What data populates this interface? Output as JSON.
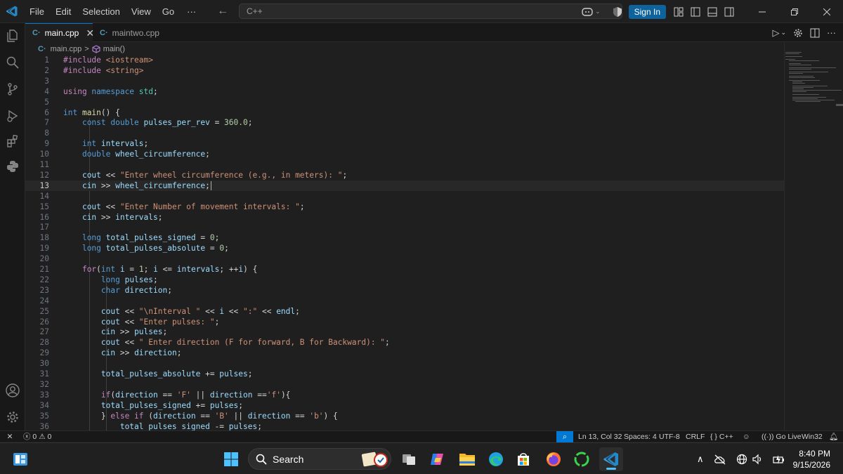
{
  "titlebar": {
    "menu": [
      "File",
      "Edit",
      "Selection",
      "View",
      "Go"
    ],
    "more": "···",
    "command_center": "C++",
    "signin_label": "Sign In"
  },
  "tabs": [
    {
      "label": "main.cpp",
      "active": true,
      "icon": "cpp-file-icon"
    },
    {
      "label": "maintwo.cpp",
      "active": false,
      "icon": "cpp-file-icon"
    }
  ],
  "breadcrumb": {
    "file": "main.cpp",
    "separator": ">",
    "symbol": "main()"
  },
  "editor": {
    "current_line": 13,
    "lines": [
      {
        "n": "1",
        "tokens": [
          [
            "pp",
            "#include "
          ],
          [
            "str",
            "<iostream>"
          ]
        ]
      },
      {
        "n": "2",
        "tokens": [
          [
            "pp",
            "#include "
          ],
          [
            "str",
            "<string>"
          ]
        ]
      },
      {
        "n": "3",
        "tokens": []
      },
      {
        "n": "4",
        "tokens": [
          [
            "kw2",
            "using "
          ],
          [
            "kw",
            "namespace "
          ],
          [
            "ty2",
            "std"
          ],
          [
            "op",
            ";"
          ]
        ]
      },
      {
        "n": "5",
        "tokens": []
      },
      {
        "n": "6",
        "tokens": [
          [
            "type",
            "int "
          ],
          [
            "fn",
            "main"
          ],
          [
            "op",
            "() {"
          ]
        ]
      },
      {
        "n": "7",
        "tokens": [
          [
            "op",
            "    "
          ],
          [
            "kw",
            "const "
          ],
          [
            "type",
            "double "
          ],
          [
            "var",
            "pulses_per_rev"
          ],
          [
            "op",
            " = "
          ],
          [
            "num",
            "360.0"
          ],
          [
            "op",
            ";"
          ]
        ]
      },
      {
        "n": "8",
        "tokens": []
      },
      {
        "n": "9",
        "tokens": [
          [
            "op",
            "    "
          ],
          [
            "type",
            "int "
          ],
          [
            "var",
            "intervals"
          ],
          [
            "op",
            ";"
          ]
        ]
      },
      {
        "n": "10",
        "tokens": [
          [
            "op",
            "    "
          ],
          [
            "type",
            "double "
          ],
          [
            "var",
            "wheel_circumference"
          ],
          [
            "op",
            ";"
          ]
        ]
      },
      {
        "n": "11",
        "tokens": []
      },
      {
        "n": "12",
        "tokens": [
          [
            "op",
            "    "
          ],
          [
            "var",
            "cout"
          ],
          [
            "op",
            " << "
          ],
          [
            "str",
            "\"Enter wheel circumference (e.g., in meters): \""
          ],
          [
            "op",
            ";"
          ]
        ]
      },
      {
        "n": "13",
        "tokens": [
          [
            "op",
            "    "
          ],
          [
            "var",
            "cin"
          ],
          [
            "op",
            " >> "
          ],
          [
            "var",
            "wheel_circumference"
          ],
          [
            "op",
            ";"
          ]
        ]
      },
      {
        "n": "14",
        "tokens": []
      },
      {
        "n": "15",
        "tokens": [
          [
            "op",
            "    "
          ],
          [
            "var",
            "cout"
          ],
          [
            "op",
            " << "
          ],
          [
            "str",
            "\"Enter Number of movement intervals: \""
          ],
          [
            "op",
            ";"
          ]
        ]
      },
      {
        "n": "16",
        "tokens": [
          [
            "op",
            "    "
          ],
          [
            "var",
            "cin"
          ],
          [
            "op",
            " >> "
          ],
          [
            "var",
            "intervals"
          ],
          [
            "op",
            ";"
          ]
        ]
      },
      {
        "n": "17",
        "tokens": []
      },
      {
        "n": "18",
        "tokens": [
          [
            "op",
            "    "
          ],
          [
            "type",
            "long "
          ],
          [
            "var",
            "total_pulses_signed"
          ],
          [
            "op",
            " = "
          ],
          [
            "num",
            "0"
          ],
          [
            "op",
            ";"
          ]
        ]
      },
      {
        "n": "19",
        "tokens": [
          [
            "op",
            "    "
          ],
          [
            "type",
            "long "
          ],
          [
            "var",
            "total_pulses_absolute"
          ],
          [
            "op",
            " = "
          ],
          [
            "num",
            "0"
          ],
          [
            "op",
            ";"
          ]
        ]
      },
      {
        "n": "20",
        "tokens": []
      },
      {
        "n": "21",
        "tokens": [
          [
            "op",
            "    "
          ],
          [
            "kw2",
            "for"
          ],
          [
            "op",
            "("
          ],
          [
            "type",
            "int "
          ],
          [
            "var",
            "i"
          ],
          [
            "op",
            " = "
          ],
          [
            "num",
            "1"
          ],
          [
            "op",
            "; "
          ],
          [
            "var",
            "i"
          ],
          [
            "op",
            " <= "
          ],
          [
            "var",
            "intervals"
          ],
          [
            "op",
            "; ++"
          ],
          [
            "var",
            "i"
          ],
          [
            "op",
            ") {"
          ]
        ]
      },
      {
        "n": "22",
        "tokens": [
          [
            "op",
            "        "
          ],
          [
            "type",
            "long "
          ],
          [
            "var",
            "pulses"
          ],
          [
            "op",
            ";"
          ]
        ]
      },
      {
        "n": "23",
        "tokens": [
          [
            "op",
            "        "
          ],
          [
            "type",
            "char "
          ],
          [
            "var",
            "direction"
          ],
          [
            "op",
            ";"
          ]
        ]
      },
      {
        "n": "24",
        "tokens": []
      },
      {
        "n": "25",
        "tokens": [
          [
            "op",
            "        "
          ],
          [
            "var",
            "cout"
          ],
          [
            "op",
            " << "
          ],
          [
            "str",
            "\"\\nInterval \""
          ],
          [
            "op",
            " << "
          ],
          [
            "var",
            "i"
          ],
          [
            "op",
            " << "
          ],
          [
            "str",
            "\":\""
          ],
          [
            "op",
            " << "
          ],
          [
            "var",
            "endl"
          ],
          [
            "op",
            ";"
          ]
        ]
      },
      {
        "n": "26",
        "tokens": [
          [
            "op",
            "        "
          ],
          [
            "var",
            "cout"
          ],
          [
            "op",
            " << "
          ],
          [
            "str",
            "\"Enter pulses: \""
          ],
          [
            "op",
            ";"
          ]
        ]
      },
      {
        "n": "27",
        "tokens": [
          [
            "op",
            "        "
          ],
          [
            "var",
            "cin"
          ],
          [
            "op",
            " >> "
          ],
          [
            "var",
            "pulses"
          ],
          [
            "op",
            ";"
          ]
        ]
      },
      {
        "n": "28",
        "tokens": [
          [
            "op",
            "        "
          ],
          [
            "var",
            "cout"
          ],
          [
            "op",
            " << "
          ],
          [
            "str",
            "\" Enter direction (F for forward, B for Backward): \""
          ],
          [
            "op",
            ";"
          ]
        ]
      },
      {
        "n": "29",
        "tokens": [
          [
            "op",
            "        "
          ],
          [
            "var",
            "cin"
          ],
          [
            "op",
            " >> "
          ],
          [
            "var",
            "direction"
          ],
          [
            "op",
            ";"
          ]
        ]
      },
      {
        "n": "30",
        "tokens": []
      },
      {
        "n": "31",
        "tokens": [
          [
            "op",
            "        "
          ],
          [
            "var",
            "total_pulses_absolute"
          ],
          [
            "op",
            " += "
          ],
          [
            "var",
            "pulses"
          ],
          [
            "op",
            ";"
          ]
        ]
      },
      {
        "n": "32",
        "tokens": []
      },
      {
        "n": "33",
        "tokens": [
          [
            "op",
            "        "
          ],
          [
            "kw2",
            "if"
          ],
          [
            "op",
            "("
          ],
          [
            "var",
            "direction"
          ],
          [
            "op",
            " == "
          ],
          [
            "str",
            "'F'"
          ],
          [
            "op",
            " || "
          ],
          [
            "var",
            "direction"
          ],
          [
            "op",
            " =="
          ],
          [
            "str",
            "'f'"
          ],
          [
            "op",
            "){"
          ]
        ]
      },
      {
        "n": "34",
        "tokens": [
          [
            "op",
            "        "
          ],
          [
            "var",
            "total_pulses_signed"
          ],
          [
            "op",
            " += "
          ],
          [
            "var",
            "pulses"
          ],
          [
            "op",
            ";"
          ]
        ]
      },
      {
        "n": "35",
        "tokens": [
          [
            "op",
            "        } "
          ],
          [
            "kw2",
            "else if "
          ],
          [
            "op",
            "("
          ],
          [
            "var",
            "direction"
          ],
          [
            "op",
            " == "
          ],
          [
            "str",
            "'B'"
          ],
          [
            "op",
            " || "
          ],
          [
            "var",
            "direction"
          ],
          [
            "op",
            " == "
          ],
          [
            "str",
            "'b'"
          ],
          [
            "op",
            ") {"
          ]
        ]
      },
      {
        "n": "36",
        "tokens": [
          [
            "op",
            "            "
          ],
          [
            "var",
            "total_pulses_signed"
          ],
          [
            "op",
            " -= "
          ],
          [
            "var",
            "pulses"
          ],
          [
            "op",
            ";"
          ]
        ]
      }
    ]
  },
  "statusbar": {
    "errors": "0",
    "warnings": "0",
    "cursor": "Ln 13, Col 32",
    "spaces": "Spaces: 4",
    "encoding": "UTF-8",
    "eol": "CRLF",
    "language": "{ } C++",
    "golive": "Go Live",
    "platform": "Win32"
  },
  "taskbar": {
    "search_label": "Search",
    "time": "8:40 PM",
    "date": "9/15/2026"
  },
  "colors": {
    "accent": "#0078d4",
    "signin": "#0e639c",
    "editor_bg": "#1f1f1f"
  }
}
